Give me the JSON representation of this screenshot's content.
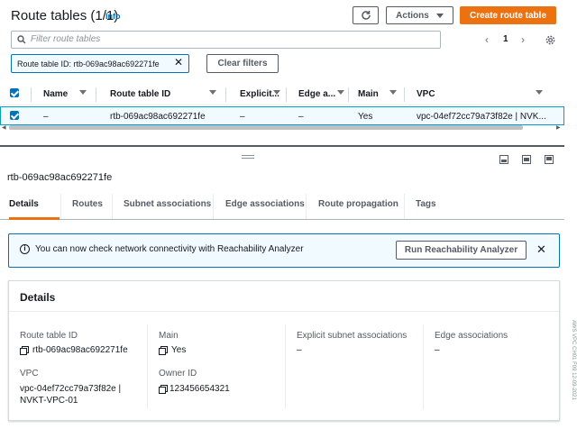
{
  "header": {
    "title": "Route tables (1/1)",
    "info_label": "Info",
    "actions_label": "Actions",
    "create_label": "Create route table"
  },
  "search": {
    "placeholder": "Filter route tables"
  },
  "filter": {
    "token_label": "Route table ID: rtb-069ac98ac692271fe",
    "clear_label": "Clear filters"
  },
  "pagination": {
    "current_page": "1"
  },
  "table": {
    "columns": [
      "Name",
      "Route table ID",
      "Explicit subnet associations",
      "Edge associations",
      "Main",
      "VPC"
    ],
    "column_display": [
      "Name",
      "Route table ID",
      "Explicit...",
      "Edge a...",
      "Main",
      "VPC"
    ],
    "rows": [
      {
        "name": "–",
        "route_table_id": "rtb-069ac98ac692271fe",
        "explicit": "–",
        "edge": "–",
        "main": "Yes",
        "vpc": "vpc-04ef72cc79a73f82e | NVK..."
      }
    ]
  },
  "detail": {
    "resource_title": "rtb-069ac98ac692271fe",
    "tabs": [
      "Details",
      "Routes",
      "Subnet associations",
      "Edge associations",
      "Route propagation",
      "Tags"
    ],
    "alert_text": "You can now check network connectivity with Reachability Analyzer",
    "alert_button": "Run Reachability Analyzer",
    "section_title": "Details",
    "fields": {
      "route_table_id_label": "Route table ID",
      "route_table_id_value": "rtb-069ac98ac692271fe",
      "main_label": "Main",
      "main_value": "Yes",
      "explicit_label": "Explicit subnet associations",
      "explicit_value": "–",
      "edge_label": "Edge associations",
      "edge_value": "–",
      "vpc_label": "VPC",
      "vpc_value_line1": "vpc-04ef72cc79a73f82e |",
      "vpc_value_line2": "NVKT-VPC-01",
      "owner_label": "Owner ID",
      "owner_value": "123456654321"
    }
  },
  "watermark": "AWS VPC CH01 F09 12-09-2021",
  "colors": {
    "primary": "#ec7211",
    "link": "#0073bb",
    "selected_row": "#f1faff",
    "text": "#16191f"
  }
}
